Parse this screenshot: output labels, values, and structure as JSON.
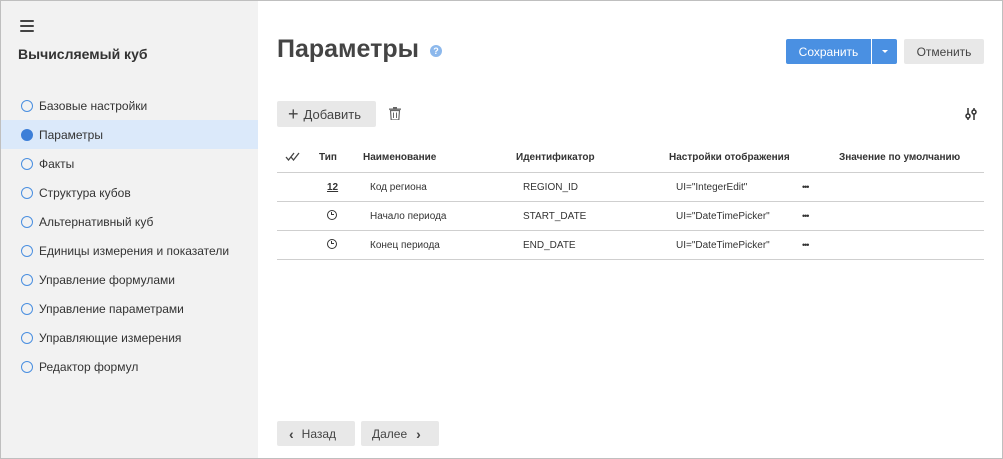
{
  "sidebar": {
    "title": "Вычисляемый куб",
    "items": [
      {
        "label": "Базовые настройки",
        "active": false
      },
      {
        "label": "Параметры",
        "active": true
      },
      {
        "label": "Факты",
        "active": false
      },
      {
        "label": "Структура кубов",
        "active": false
      },
      {
        "label": "Альтернативный куб",
        "active": false
      },
      {
        "label": "Единицы измерения и показатели",
        "active": false
      },
      {
        "label": "Управление формулами",
        "active": false
      },
      {
        "label": "Управление параметрами",
        "active": false
      },
      {
        "label": "Управляющие измерения",
        "active": false
      },
      {
        "label": "Редактор формул",
        "active": false
      }
    ]
  },
  "header": {
    "title": "Параметры",
    "help_icon": "?",
    "save_label": "Сохранить",
    "cancel_label": "Отменить"
  },
  "toolbar": {
    "add_label": "Добавить"
  },
  "table": {
    "columns": {
      "type": "Тип",
      "name": "Наименование",
      "id": "Идентификатор",
      "display": "Настройки отображения",
      "default": "Значение по умолчанию"
    },
    "rows": [
      {
        "type_icon": "number-icon",
        "type_text": "12",
        "name": "Код региона",
        "id": "REGION_ID",
        "display": "UI=\"IntegerEdit\"",
        "default": ""
      },
      {
        "type_icon": "clock-icon",
        "type_text": "",
        "name": "Начало периода",
        "id": "START_DATE",
        "display": "UI=\"DateTimePicker\"",
        "default": ""
      },
      {
        "type_icon": "clock-icon",
        "type_text": "",
        "name": "Конец периода",
        "id": "END_DATE",
        "display": "UI=\"DateTimePicker\"",
        "default": ""
      }
    ],
    "more_glyph": "•••"
  },
  "footer": {
    "back_label": "Назад",
    "next_label": "Далее"
  },
  "colors": {
    "accent": "#4a90e2",
    "sidebar_bg": "#f2f2f2",
    "active_item_bg": "#dbe9fa"
  }
}
